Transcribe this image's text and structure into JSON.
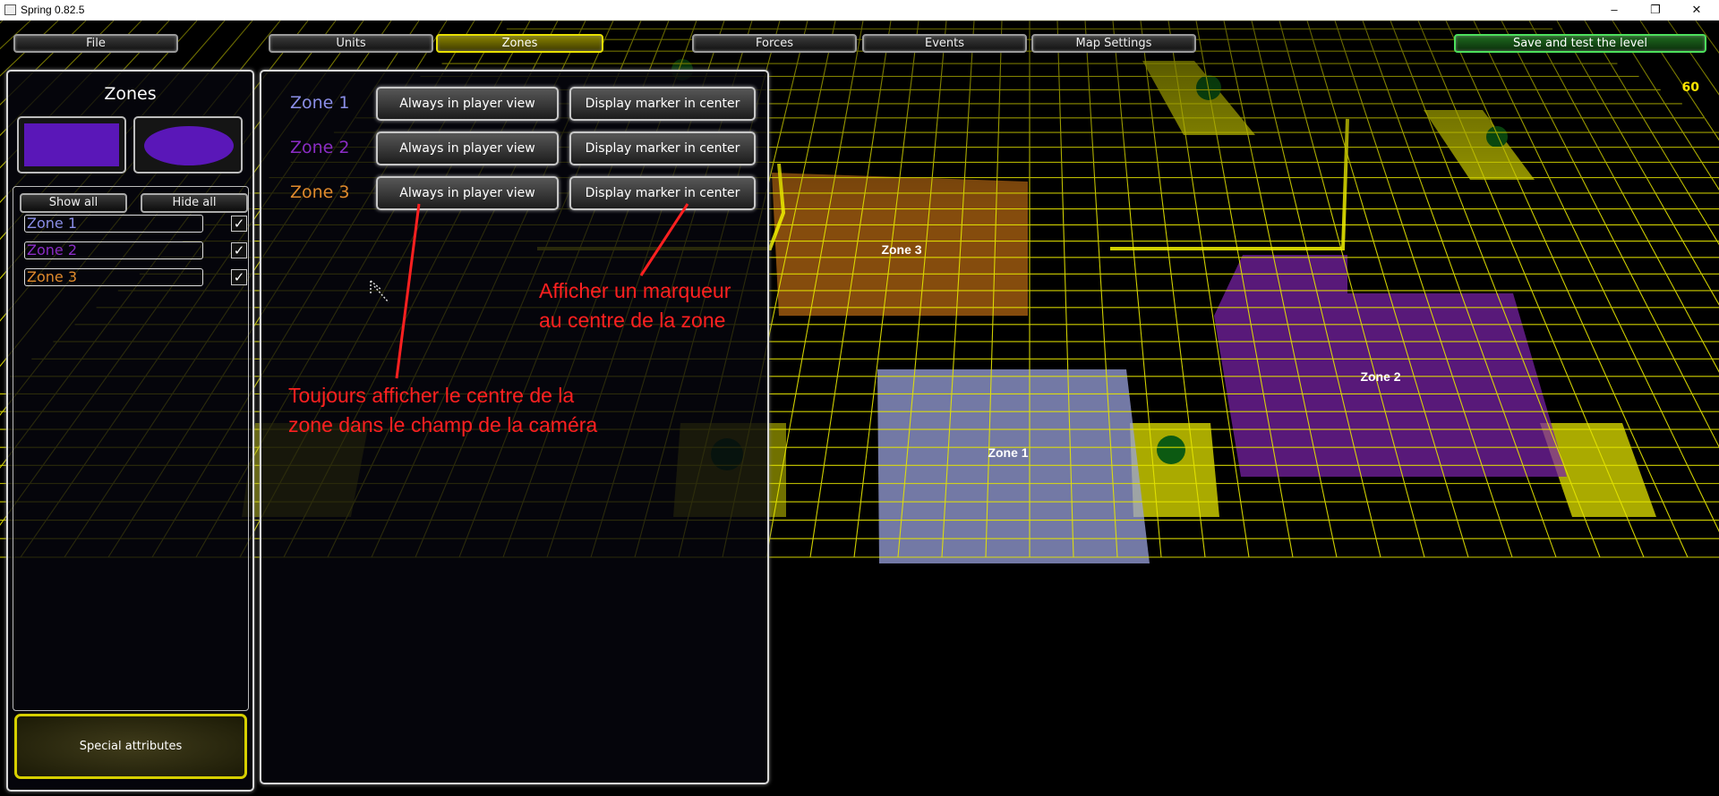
{
  "window": {
    "title": "Spring 0.82.5",
    "minimize": "–",
    "restore": "❐",
    "close": "✕"
  },
  "toolbar": {
    "file": "File",
    "units": "Units",
    "zones": "Zones",
    "forces": "Forces",
    "events": "Events",
    "map_settings": "Map Settings",
    "save": "Save and test the level"
  },
  "zones_panel": {
    "title": "Zones",
    "show_all": "Show all",
    "hide_all": "Hide all",
    "items": [
      {
        "label": "Zone 1",
        "checked": "✓",
        "color": "#8a8ee6"
      },
      {
        "label": "Zone 2",
        "checked": "✓",
        "color": "#8a2cc4"
      },
      {
        "label": "Zone 3",
        "checked": "✓",
        "color": "#e08a2c"
      }
    ],
    "special_attributes": "Special attributes"
  },
  "zone_options": {
    "rows": [
      {
        "label": "Zone 1",
        "always": "Always in player view",
        "marker": "Display marker in center"
      },
      {
        "label": "Zone 2",
        "always": "Always in player view",
        "marker": "Display marker in center"
      },
      {
        "label": "Zone 3",
        "always": "Always in player view",
        "marker": "Display marker in center"
      }
    ]
  },
  "annotations": {
    "marker_line1": "Afficher un marqueur",
    "marker_line2": "au centre de la zone",
    "view_line1": "Toujours afficher le centre de la",
    "view_line2": "zone dans le champ de la caméra"
  },
  "map": {
    "zone1": "Zone 1",
    "zone2": "Zone 2",
    "zone3": "Zone 3",
    "fps": "60"
  },
  "colors": {
    "grid": "#e6e600",
    "zone1_fill": "#9aa2dc",
    "zone2_fill": "#7a22a8",
    "zone3_fill": "#b86a12",
    "annotation": "#ff2020"
  }
}
